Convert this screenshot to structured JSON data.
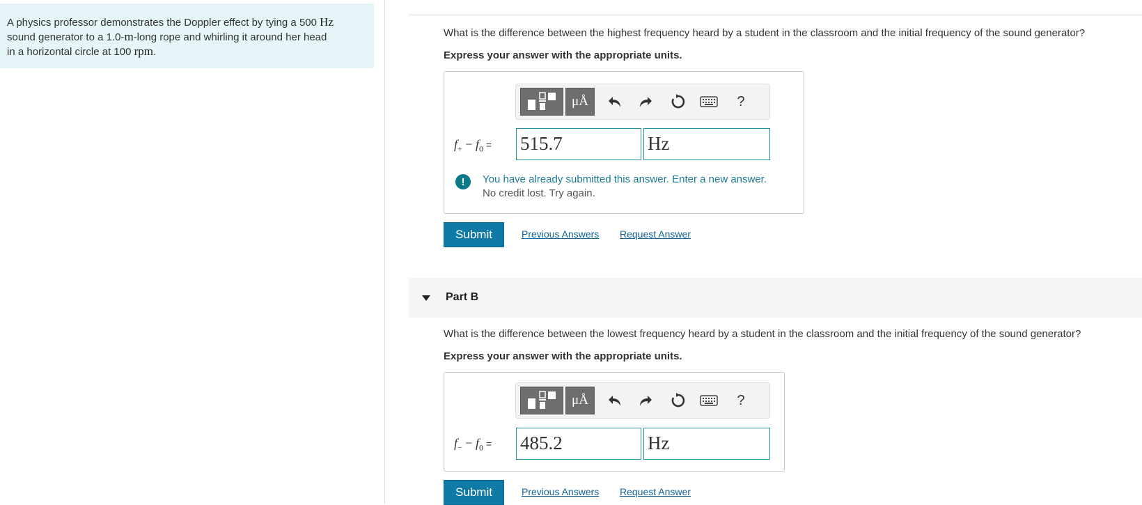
{
  "problem": {
    "line1_pre": "A physics professor demonstrates the Doppler effect by tying a 500 ",
    "line1_unit": "Hz",
    "line2_pre": "sound generator to a 1.0-",
    "line2_unit": "m",
    "line2_post": "-long rope and whirling it around her head",
    "line3_pre": "in a horizontal circle at 100 ",
    "line3_unit": "rpm",
    "line3_post": "."
  },
  "part_a": {
    "question": "What is the difference between the highest frequency heard by a student in the classroom and the initial frequency of the sound generator?",
    "instruction": "Express your answer with the appropriate units.",
    "var_main": "f",
    "var_sub": "+",
    "minus": " − ",
    "var2_main": "f",
    "var2_sub": "0",
    "eq": " =",
    "value": "515.7",
    "unit": "Hz",
    "feedback_line1": "You have already submitted this answer. Enter a new answer.",
    "feedback_line2": "No credit lost. Try again.",
    "feedback_icon": "!",
    "submit": "Submit",
    "previous_answers": "Previous Answers",
    "request_answer": "Request Answer"
  },
  "part_b": {
    "title": "Part B",
    "question": "What is the difference between the lowest frequency heard by a student in the classroom and the initial frequency of the sound generator?",
    "instruction": "Express your answer with the appropriate units.",
    "var_main": "f",
    "var_sub": "−",
    "minus": " − ",
    "var2_main": "f",
    "var2_sub": "0",
    "eq": " =",
    "value": "485.2",
    "unit": "Hz",
    "submit": "Submit",
    "previous_answers": "Previous Answers",
    "request_answer": "Request Answer"
  },
  "toolbar": {
    "units_label": "μÅ",
    "help": "?"
  },
  "icons": {
    "template": "fraction-template-icon",
    "units": "units-icon",
    "undo": "undo-icon",
    "redo": "redo-icon",
    "reset": "reset-icon",
    "keyboard": "keyboard-icon",
    "help": "help-icon",
    "collapse": "caret-down-icon"
  },
  "colors": {
    "accent": "#0f7aa6",
    "field_border": "#1f8ea0",
    "problem_bg": "#e6f5f7",
    "link": "#12639a",
    "warning": "#0a7a8a"
  }
}
